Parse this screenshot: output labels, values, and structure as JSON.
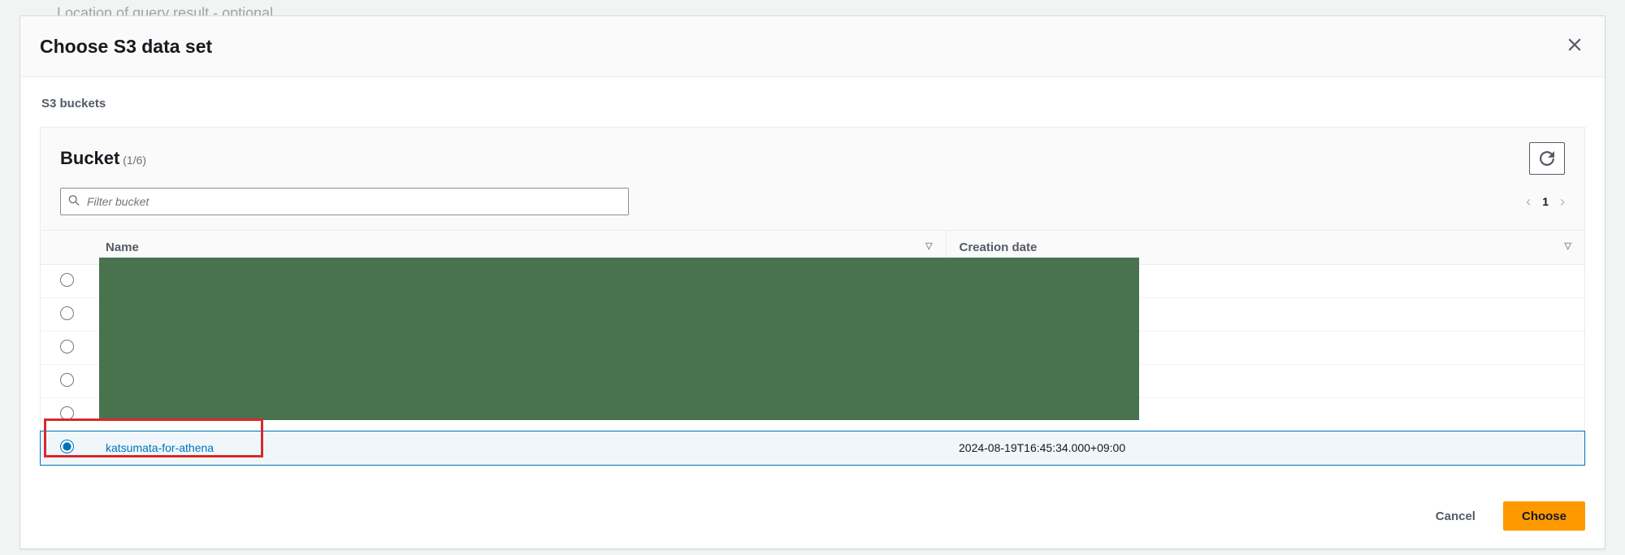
{
  "background_label": "Location of query result - optional",
  "modal": {
    "title": "Choose S3 data set",
    "breadcrumb": "S3 buckets",
    "panel_title": "Bucket",
    "panel_count": "(1/6)",
    "filter_placeholder": "Filter bucket",
    "page_number": "1",
    "columns": {
      "name": "Name",
      "creation_date": "Creation date"
    },
    "rows": [
      {
        "selected": false,
        "name": "",
        "creation_date": ""
      },
      {
        "selected": false,
        "name": "",
        "creation_date": ""
      },
      {
        "selected": false,
        "name": "",
        "creation_date": ""
      },
      {
        "selected": false,
        "name": "",
        "creation_date": ""
      },
      {
        "selected": false,
        "name": "",
        "creation_date": ""
      },
      {
        "selected": true,
        "name": "katsumata-for-athena",
        "creation_date": "2024-08-19T16:45:34.000+09:00"
      }
    ],
    "buttons": {
      "cancel": "Cancel",
      "choose": "Choose"
    }
  }
}
